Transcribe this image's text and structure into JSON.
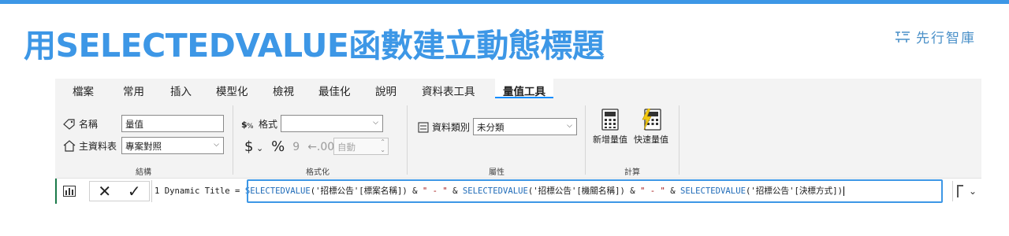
{
  "slide": {
    "title": "用SELECTEDVALUE函數建立動態標題",
    "logo_text": "先行智庫"
  },
  "ribbon": {
    "tabs": [
      {
        "label": "檔案"
      },
      {
        "label": "常用"
      },
      {
        "label": "插入"
      },
      {
        "label": "模型化"
      },
      {
        "label": "檢視"
      },
      {
        "label": "最佳化"
      },
      {
        "label": "說明"
      },
      {
        "label": "資料表工具"
      },
      {
        "label": "量值工具"
      }
    ],
    "structure": {
      "name_label": "名稱",
      "name_value": "量值",
      "home_table_label": "主資料表",
      "home_table_value": "專案對照",
      "group_label": "結構"
    },
    "formatting": {
      "format_label": "格式",
      "format_value": "",
      "currency_symbol": "$",
      "percent_symbol": "%",
      "comma_symbol": "9",
      "decimal_symbol": "←.00",
      "decimal_value": "自動",
      "group_label": "格式化"
    },
    "properties": {
      "category_label": "資料類別",
      "category_value": "未分類",
      "group_label": "屬性"
    },
    "calculations": {
      "new_measure": "新增量值",
      "quick_measure": "快速量值",
      "group_label": "計算"
    }
  },
  "formula_bar": {
    "line_prefix": "1  Dynamic Title = ",
    "segments": [
      {
        "text": "SELECTEDVALUE",
        "kind": "kw"
      },
      {
        "text": "('招標公告'[標案名稱]) & ",
        "kind": "plain"
      },
      {
        "text": "\" - \"",
        "kind": "str"
      },
      {
        "text": " & ",
        "kind": "plain"
      },
      {
        "text": "SELECTEDVALUE",
        "kind": "kw"
      },
      {
        "text": "('招標公告'[機關名稱]) & ",
        "kind": "plain"
      },
      {
        "text": "\" - \"",
        "kind": "str"
      },
      {
        "text": " & ",
        "kind": "plain"
      },
      {
        "text": "SELECTEDVALUE",
        "kind": "kw"
      },
      {
        "text": "('招標公告'[決標方式])",
        "kind": "plain"
      }
    ],
    "cancel_glyph": "✕",
    "commit_glyph": "✓"
  },
  "colors": {
    "accent": "#3d97e6",
    "power_bi_yellow": "#f2c811",
    "keyword": "#1f6bb8",
    "string": "#a31515"
  }
}
